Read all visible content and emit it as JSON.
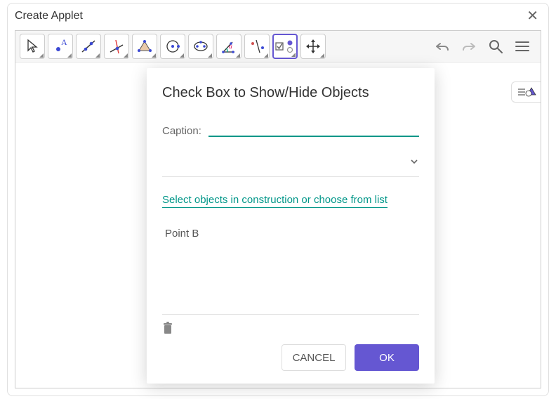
{
  "window": {
    "title": "Create Applet"
  },
  "toolbar": {
    "tools": [
      {
        "name": "move-tool"
      },
      {
        "name": "point-tool"
      },
      {
        "name": "line-tool"
      },
      {
        "name": "perpendicular-line-tool"
      },
      {
        "name": "polygon-tool"
      },
      {
        "name": "circle-tool"
      },
      {
        "name": "ellipse-tool"
      },
      {
        "name": "angle-tool"
      },
      {
        "name": "reflect-tool"
      },
      {
        "name": "slider-tool",
        "selected": true
      },
      {
        "name": "move-graphics-tool"
      }
    ]
  },
  "dialog": {
    "title": "Check Box to Show/Hide Objects",
    "caption_label": "Caption:",
    "caption_value": "",
    "instruction": "Select objects in construction or choose from list",
    "objects": [
      {
        "label": "Point B"
      }
    ],
    "cancel_label": "CANCEL",
    "ok_label": "OK"
  }
}
